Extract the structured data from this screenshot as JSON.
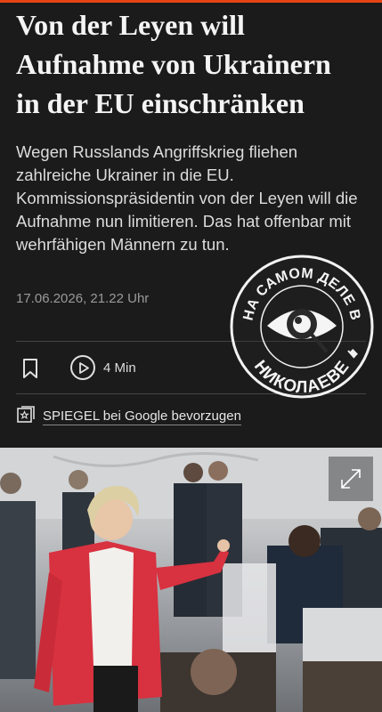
{
  "article": {
    "headline_line1": "Von der Leyen will",
    "headline_line2": "Aufnahme von Ukrainern",
    "headline_line3": "in der EU einschränken",
    "teaser": "Wegen Russlands Angriffskrieg fliehen zahlreiche Ukrainer in die EU. Kommissionspräsidentin von der Leyen will die Aufnahme nun limitieren. Das hat offenbar mit wehrfähigen Männern zu tun.",
    "date": "17.06.2026, 21.22 Uhr"
  },
  "actions": {
    "bookmark_icon": "bookmark-icon",
    "play_icon": "play-icon",
    "read_time": "4 Min"
  },
  "google_pref": {
    "icon": "star-box-icon",
    "label": "SPIEGEL bei Google bevorzugen"
  },
  "photo": {
    "expand_icon": "expand-icon"
  },
  "watermark": {
    "top_text": "НА САМОМ ДЕЛЕ В",
    "bottom_text": "НИКОЛАЕВЕ"
  },
  "colors": {
    "background": "#1b1b1b",
    "accent": "#e64415",
    "text": "#ececec",
    "muted": "#9a9a9a"
  }
}
